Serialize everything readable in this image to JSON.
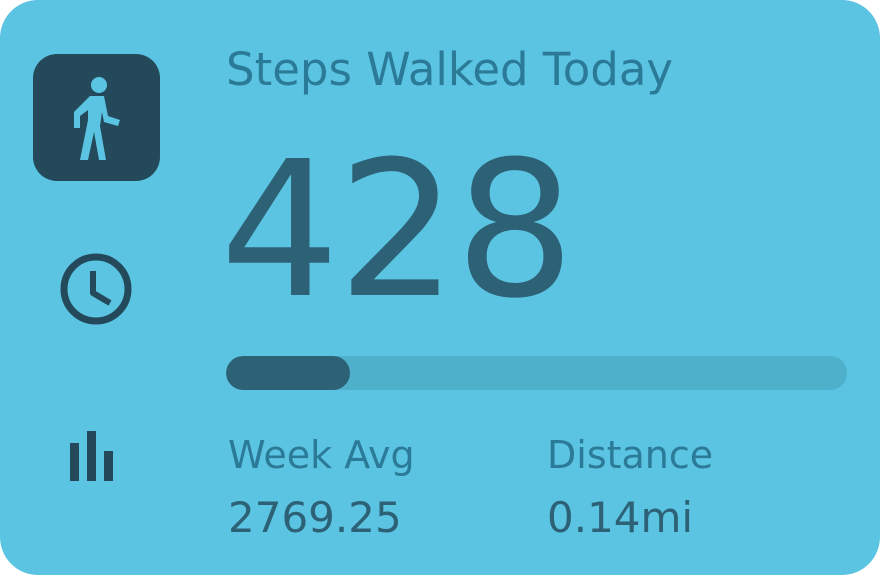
{
  "widget": {
    "title": "Steps Walked Today",
    "steps": "428",
    "progress_fraction": 0.2,
    "stats": [
      {
        "label": "Week Avg",
        "value": "2769.25"
      },
      {
        "label": "Distance",
        "value": "0.14mi"
      }
    ]
  },
  "icons": {
    "primary": "walking-person-icon",
    "secondary": [
      "clock-icon",
      "bar-chart-icon"
    ]
  },
  "colors": {
    "card_background": "#5bc4e2",
    "icon_tile": "#23495a",
    "accent_dark": "#2d6175",
    "label_text": "#2b7a98",
    "progress_track": "#4fb0cc"
  }
}
